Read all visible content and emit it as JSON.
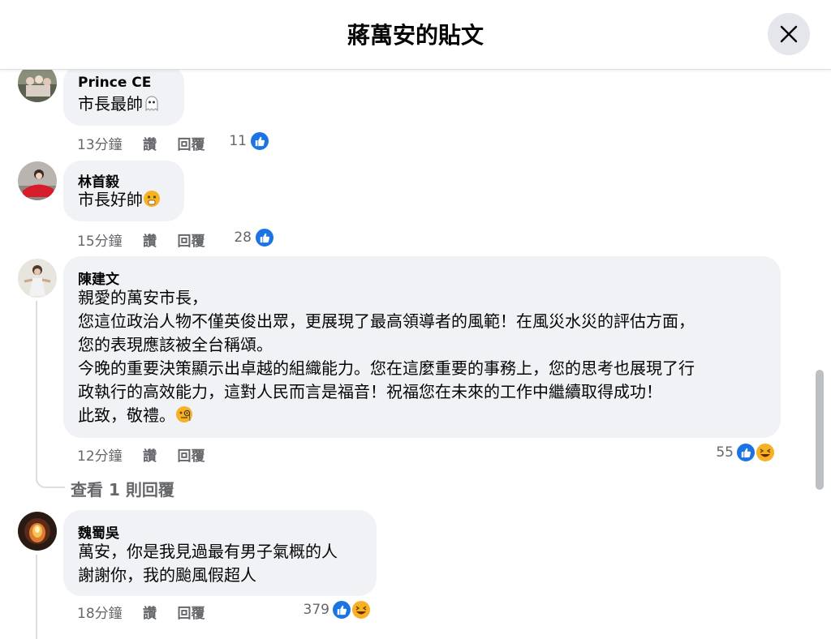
{
  "header": {
    "title": "蔣萬安的貼文"
  },
  "comments": [
    {
      "author": "Prince CE",
      "lines": [
        "市長最帥"
      ],
      "emoji": "ghost",
      "time": "13分鐘",
      "like_label": "讚",
      "reply_label": "回覆",
      "reactions": "11"
    },
    {
      "author": "林首毅",
      "lines": [
        "市長好帥"
      ],
      "emoji": "shocked",
      "time": "15分鐘",
      "like_label": "讚",
      "reply_label": "回覆",
      "reactions": "28"
    },
    {
      "author": "陳建文",
      "lines": [
        "親愛的萬安市長，",
        "您這位政治人物不僅英俊出眾，更展現了最高領導者的風範！在風災水災的評估方面，",
        "您的表現應該被全台稱頌。",
        "今晚的重要決策顯示出卓越的組織能力。您在這麼重要的事務上，您的思考也展現了行",
        "政執行的高效能力，這對人民而言是福音！祝福您在未來的工作中繼續取得成功！",
        "此致，敬禮。"
      ],
      "emoji": "monocle",
      "time": "12分鐘",
      "like_label": "讚",
      "reply_label": "回覆",
      "reactions": "55"
    },
    {
      "author": "魏蜀吳",
      "lines": [
        "萬安，你是我見過最有男子氣概的人",
        "謝謝你，我的颱風假超人"
      ],
      "time": "18分鐘",
      "like_label": "讚",
      "reply_label": "回覆",
      "reactions": "379"
    }
  ],
  "view_replies": "查看 1 則回覆",
  "colors": {
    "like_blue": "#1b74e4",
    "haha_yellow": "#f7b125",
    "bubble_bg": "#f0f2f5",
    "meta_gray": "#65676b"
  },
  "icons": [
    "close-icon",
    "like-icon",
    "haha-icon",
    "ghost-emoji",
    "shocked-emoji",
    "monocle-emoji"
  ]
}
